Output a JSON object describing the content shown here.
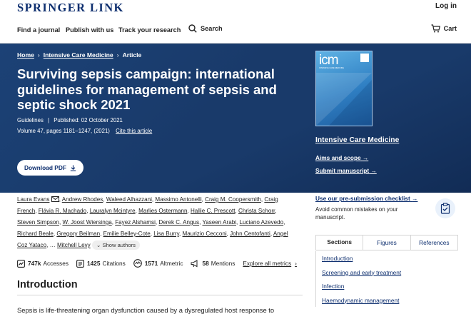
{
  "header": {
    "logo": "SPRINGER LINK",
    "login": "Log in"
  },
  "nav": {
    "find_journal": "Find a journal",
    "publish": "Publish with us",
    "track": "Track your research",
    "search": "Search",
    "cart": "Cart"
  },
  "breadcrumb": {
    "home": "Home",
    "journal": "Intensive Care Medicine",
    "current": "Article",
    "separator": "›"
  },
  "article": {
    "title": "Surviving sepsis campaign: international guidelines for management of sepsis and septic shock 2021",
    "type": "Guidelines",
    "published": "Published: 02 October 2021",
    "meta_sep": "|",
    "volume": "Volume 47, pages 1181–1247, (2021)",
    "cite": "Cite this article",
    "download_pdf": "Download PDF"
  },
  "journal": {
    "name": "Intensive Care Medicine",
    "cover_mark": "icm",
    "cover_subtitle": "INTENSIVE CARE MEDICINE",
    "aims": "Aims and scope",
    "submit": "Submit manuscript"
  },
  "authors": [
    "Laura Evans",
    "Andrew Rhodes",
    "Waleed Alhazzani",
    "Massimo Antonelli",
    "Craig M. Coopersmith",
    "Craig French",
    "Flávia R. Machado",
    "Lauralyn Mcintyre",
    "Marlies Ostermann",
    "Hallie C. Prescott",
    "Christa Schorr",
    "Steven Simpson",
    "W. Joost Wiersinga",
    "Fayez Alshamsi",
    "Derek C. Angus",
    "Yaseen Arabi",
    "Luciano Azevedo",
    "Richard Beale",
    "Gregory Beilman",
    "Emilie Belley‑Cote",
    "Lisa Burry",
    "Maurizio Cecconi",
    "John Centofanti",
    "Angel Coz Yataco"
  ],
  "authors_ellipsis": "…",
  "last_author": "Mitchell Levy",
  "show_authors": "Show authors",
  "metrics": {
    "accesses_value": "747k",
    "accesses_label": "Accesses",
    "citations_value": "1425",
    "citations_label": "Citations",
    "altmetric_value": "1571",
    "altmetric_label": "Altmetric",
    "mentions_value": "58",
    "mentions_label": "Mentions",
    "explore": "Explore all metrics"
  },
  "intro": {
    "heading": "Introduction",
    "text": "Sepsis is life-threatening organ dysfunction caused by a dysregulated host response to"
  },
  "sidebar": {
    "checklist_link": "Use our pre-submission checklist",
    "checklist_desc": "Avoid common mistakes on your manuscript.",
    "tabs": [
      "Sections",
      "Figures",
      "References"
    ],
    "sections": [
      "Introduction",
      "Screening and early treatment",
      "Infection",
      "Haemodynamic management"
    ]
  },
  "colors": {
    "brand": "#0e2f6f",
    "hero_bg": "#193a6a"
  }
}
